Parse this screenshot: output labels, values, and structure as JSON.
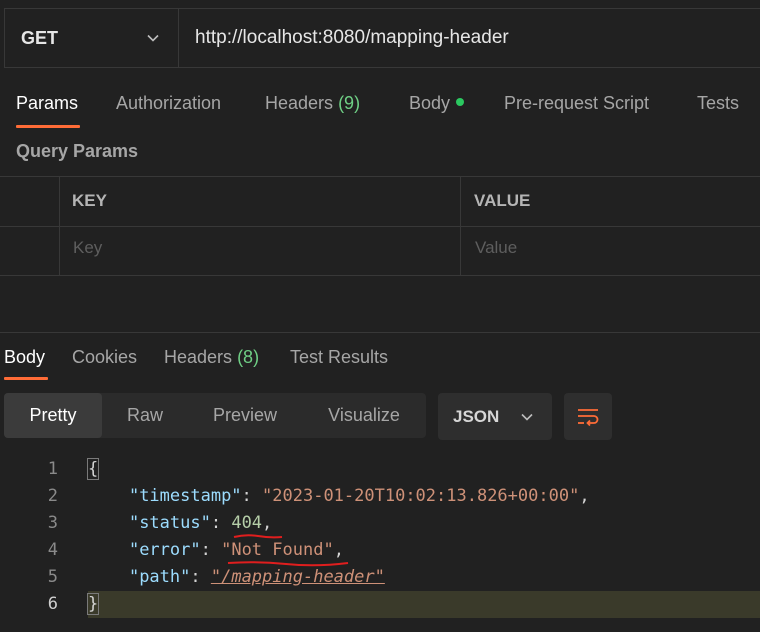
{
  "request": {
    "method": "GET",
    "url": "http://localhost:8080/mapping-header"
  },
  "request_tabs": [
    {
      "label": "Params"
    },
    {
      "label": "Authorization"
    },
    {
      "label": "Headers",
      "count": "(9)"
    },
    {
      "label": "Body"
    },
    {
      "label": "Pre-request Script"
    },
    {
      "label": "Tests"
    }
  ],
  "query_params": {
    "title": "Query Params",
    "key_header": "KEY",
    "value_header": "VALUE",
    "key_placeholder": "Key",
    "value_placeholder": "Value"
  },
  "response_tabs": [
    {
      "label": "Body"
    },
    {
      "label": "Cookies"
    },
    {
      "label": "Headers",
      "count": "(8)"
    },
    {
      "label": "Test Results"
    }
  ],
  "view_modes": [
    "Pretty",
    "Raw",
    "Preview",
    "Visualize"
  ],
  "format": "JSON",
  "response_body": {
    "line_numbers": [
      "1",
      "2",
      "3",
      "4",
      "5",
      "6"
    ],
    "open_brace": "{",
    "close_brace": "}",
    "fields": [
      {
        "key": "\"timestamp\"",
        "value": "\"2023-01-20T10:02:13.826+00:00\"",
        "trail": ","
      },
      {
        "key": "\"status\"",
        "value": "404",
        "trail": ","
      },
      {
        "key": "\"error\"",
        "value": "\"Not Found\"",
        "trail": ","
      },
      {
        "key": "\"path\"",
        "value": "\"/mapping-header\"",
        "trail": ""
      }
    ]
  },
  "colors": {
    "accent": "#ff6c37",
    "body_dot": "#2bc860",
    "count_green": "#6fcf85",
    "annotation_red": "#e01e1e"
  }
}
